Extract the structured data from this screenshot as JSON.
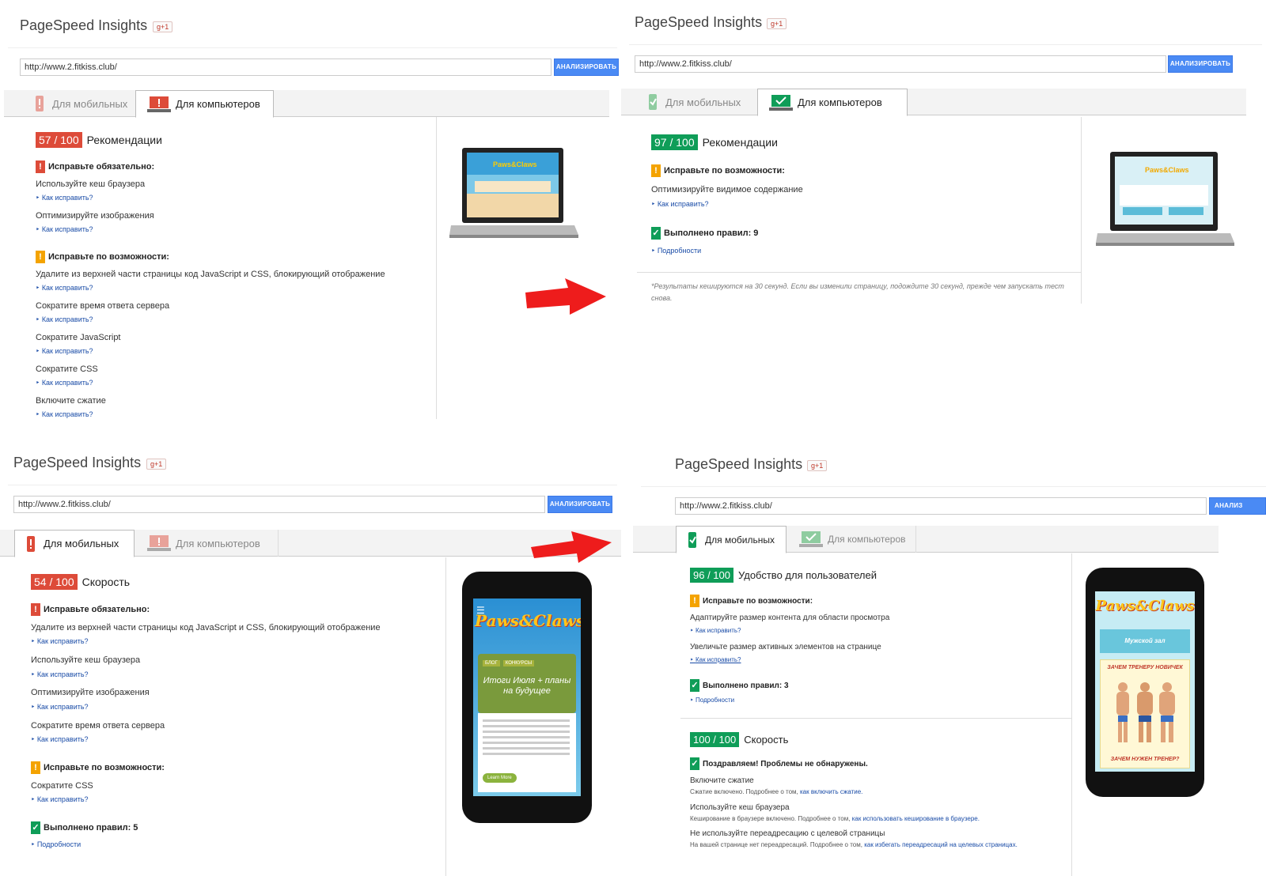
{
  "common": {
    "title": "PageSpeed Insights",
    "gplus": "g+1",
    "url": "http://www.2.fitkiss.club/",
    "analyze": "АНАЛИЗИРОВАТЬ",
    "tab_mobile": "Для мобильных",
    "tab_desktop": "Для компьютеров",
    "fix_link": "Как исправить?",
    "details_link": "Подробности"
  },
  "tl": {
    "score": "57 / 100",
    "score_label": "Рекомендации",
    "must_fix": "Исправьте обязательно:",
    "must_items": [
      "Используйте кеш браузера",
      "Оптимизируйте изображения"
    ],
    "consider": "Исправьте по возможности:",
    "consider_items": [
      "Удалите из верхней части страницы код JavaScript и CSS, блокирующий отображение",
      "Сократите время ответа сервера",
      "Сократите JavaScript",
      "Сократите CSS",
      "Включите сжатие"
    ]
  },
  "tr": {
    "score": "97 / 100",
    "score_label": "Рекомендации",
    "consider": "Исправьте по возможности:",
    "consider_item": "Оптимизируйте видимое содержание",
    "passed": "Выполнено правил: 9",
    "note": "*Результаты кешируются на 30 секунд. Если вы изменили страницу, подождите 30 секунд, прежде чем запускать тест снова."
  },
  "bl": {
    "score": "54 / 100",
    "score_label": "Скорость",
    "must_fix": "Исправьте обязательно:",
    "must_items": [
      "Удалите из верхней части страницы код JavaScript и CSS, блокирующий отображение",
      "Используйте кеш браузера",
      "Оптимизируйте изображения",
      "Сократите время ответа сервера"
    ],
    "consider": "Исправьте по возможности:",
    "consider_item": "Сократите CSS",
    "passed": "Выполнено правил: 5"
  },
  "br": {
    "analyze_cut": "АНАЛИЗ",
    "ux_score": "96 / 100",
    "ux_label": "Удобство для пользователей",
    "consider": "Исправьте по возможности:",
    "ux_items": [
      "Адаптируйте размер контента для области просмотра",
      "Увеличьте размер активных элементов на странице"
    ],
    "passed": "Выполнено правил: 3",
    "speed_score": "100 / 100",
    "speed_label": "Скорость",
    "congrats": "Поздравляем! Проблемы не обнаружены.",
    "rules": [
      {
        "title": "Включите сжатие",
        "text": "Сжатие включено. Подробнее о том, ",
        "link": "как включить сжатие."
      },
      {
        "title": "Используйте кеш браузера",
        "text": "Кеширование в браузере включено. Подробнее о том, ",
        "link": "как использовать кеширование в браузере."
      },
      {
        "title": "Не используйте переадресацию с целевой страницы",
        "text": "На вашей странице нет переадресаций. Подробнее о том, ",
        "link": "как избегать переадресаций на целевых страницах."
      }
    ]
  },
  "site": {
    "brand": "Paws&Claws",
    "post_title": "Итоги Июля + планы на будущее",
    "tags": [
      "БЛОГ",
      "КОНКУРСЫ"
    ],
    "learn_more": "Learn More",
    "gym": "Мужской зал",
    "ad1": "ЗАЧЕМ ТРЕНЕРУ НОВИЧЕК",
    "ad2": "ЗАЧЕМ НУЖЕН ТРЕНЕР?"
  },
  "colors": {
    "red": "#dd4b39",
    "green": "#0f9d58",
    "orange": "#f4a300",
    "blue": "#4a8af4",
    "arrow": "#ee1c1c"
  }
}
